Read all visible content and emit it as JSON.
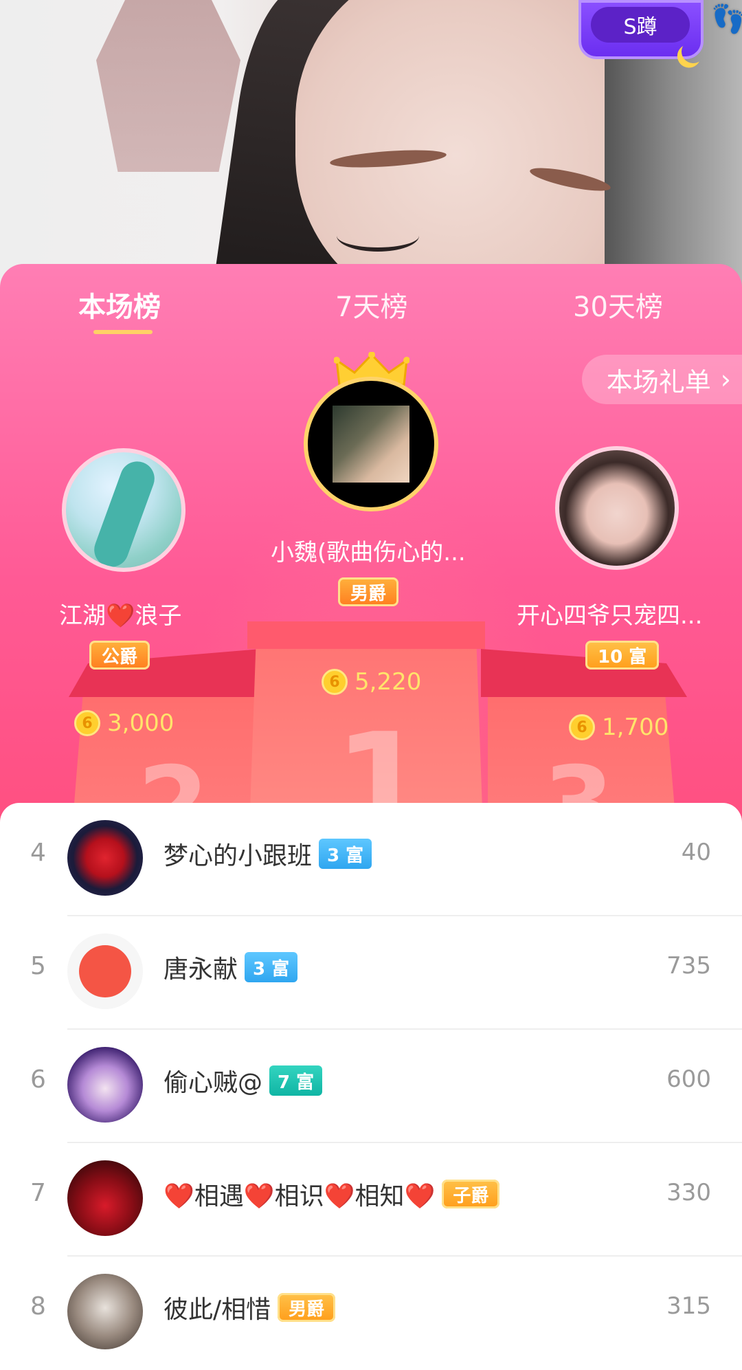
{
  "stream": {
    "pk_badge_label": "S蹲",
    "foot_icon": "footprint-icon"
  },
  "tabs": [
    {
      "label": "本场榜",
      "active": true
    },
    {
      "label": "7天榜",
      "active": false
    },
    {
      "label": "30天榜",
      "active": false
    }
  ],
  "gift_list_button": "本场礼单",
  "podium": {
    "first": {
      "rank": "1",
      "name": "小魏(歌曲伤心的...",
      "title": "男爵",
      "score": "5,220"
    },
    "second": {
      "rank": "2",
      "name_prefix": "江湖",
      "name_heart": "❤️",
      "name_suffix": "浪子",
      "title": "公爵",
      "score": "3,000"
    },
    "third": {
      "rank": "3",
      "name": "开心四爷只宠四...",
      "title": "10 富",
      "score": "1,700"
    }
  },
  "coin_symbol": "6",
  "list": [
    {
      "rank": "4",
      "name": "梦心的小跟班",
      "badge": "3 富",
      "badge_style": "blue",
      "value": "40"
    },
    {
      "rank": "5",
      "name": "唐永献",
      "badge": "3 富",
      "badge_style": "blue",
      "value": "735"
    },
    {
      "rank": "6",
      "name": "偷心贼@",
      "badge": "7 富",
      "badge_style": "teal",
      "value": "600"
    },
    {
      "rank": "7",
      "name": "❤️相遇❤️相识❤️相知❤️",
      "badge": "子爵",
      "badge_style": "gold",
      "value": "330"
    },
    {
      "rank": "8",
      "name": "彼此/相惜",
      "badge": "男爵",
      "badge_style": "gold",
      "value": "315"
    }
  ],
  "colors": {
    "panel_top": "#ff7eb4",
    "panel_bottom": "#ff4a6a",
    "tab_underline": "#ffd166",
    "score_yellow": "#ffe46b"
  }
}
